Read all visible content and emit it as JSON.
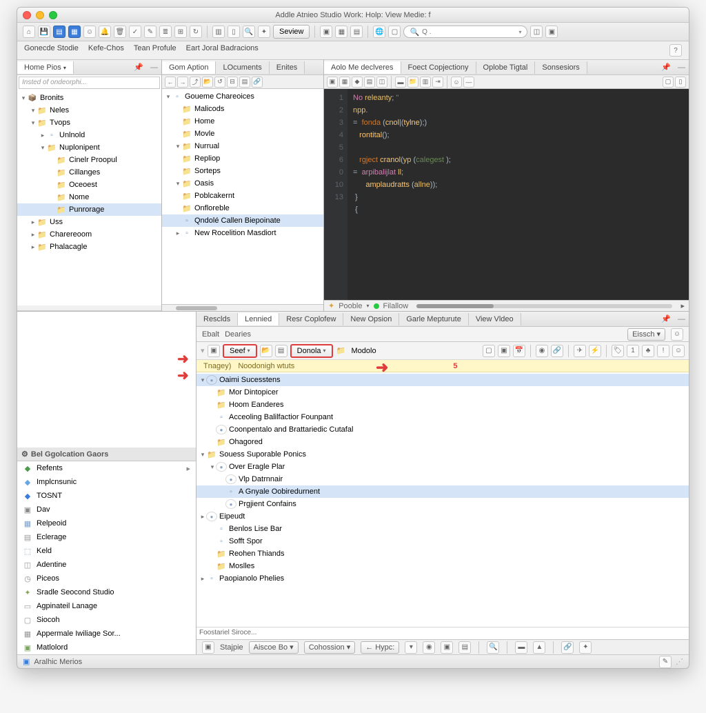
{
  "window": {
    "title": "Addle Atnieo Studio Work: Holp: View Medie: f"
  },
  "menubar": [
    "Gonecde Stodie",
    "Kefe-Chos",
    "Tean Profule",
    "Eart Joral Badracions"
  ],
  "search_placeholder": "Q .",
  "toolbar1_button": "Seview",
  "left_panel": {
    "tab_label": "Home Pios",
    "filter_placeholder": "Insted of ondeorphi...",
    "tree": [
      {
        "label": "Bronits",
        "icon": "pkg",
        "depth": 0,
        "expanded": true
      },
      {
        "label": "Neles",
        "icon": "folder",
        "depth": 1,
        "expanded": true
      },
      {
        "label": "Tvops",
        "icon": "folder",
        "depth": 1,
        "expanded": true
      },
      {
        "label": "Unlnold",
        "icon": "file",
        "depth": 2,
        "expanded": false
      },
      {
        "label": "Nuplonipent",
        "icon": "folder",
        "depth": 2,
        "expanded": true
      },
      {
        "label": "Cinelr Proopul",
        "icon": "folder",
        "depth": 3
      },
      {
        "label": "Cillanges",
        "icon": "folder",
        "depth": 3
      },
      {
        "label": "Oceoest",
        "icon": "folder",
        "depth": 3
      },
      {
        "label": "Nome",
        "icon": "folder",
        "depth": 3
      },
      {
        "label": "Punrorage",
        "icon": "folder",
        "depth": 3,
        "sel": true
      },
      {
        "label": "Uss",
        "icon": "folder",
        "depth": 1,
        "expanded": false
      },
      {
        "label": "Charereoom",
        "icon": "folder",
        "depth": 1,
        "expanded": false
      },
      {
        "label": "Phalacagle",
        "icon": "folder",
        "depth": 1,
        "expanded": false
      }
    ]
  },
  "mid_panel": {
    "tabs": [
      "Gom Aption",
      "LOcuments",
      "Enites"
    ],
    "active_tab": 0,
    "tree": [
      {
        "label": "Goueme Chareoices",
        "icon": "file",
        "depth": 0,
        "expanded": true
      },
      {
        "label": "Malicods",
        "icon": "folder",
        "depth": 1
      },
      {
        "label": "Home",
        "icon": "folder",
        "depth": 1
      },
      {
        "label": "Movle",
        "icon": "folder",
        "depth": 1
      },
      {
        "label": "Nurrual",
        "icon": "folder",
        "depth": 1,
        "expanded": true
      },
      {
        "label": "Repliop",
        "icon": "folder",
        "depth": 1
      },
      {
        "label": "Sorteps",
        "icon": "folder",
        "depth": 1
      },
      {
        "label": "Oasis",
        "icon": "folder",
        "depth": 1,
        "expanded": true
      },
      {
        "label": "Poblcakernt",
        "icon": "folder",
        "depth": 1
      },
      {
        "label": "Onfloreble",
        "icon": "folder",
        "depth": 1
      },
      {
        "label": "Qndolé Callen Biepoinate",
        "icon": "file",
        "depth": 1,
        "sel": true
      },
      {
        "label": "New Rocelition Masdiort",
        "icon": "file",
        "depth": 1,
        "expanded": false
      }
    ]
  },
  "right_panel": {
    "tabs": [
      "Aolo Me declveres",
      "Foect Copjectiony",
      "Oplobe Tigtal",
      "Sonsesiors"
    ],
    "active_tab": 0,
    "code_lines": [
      "1",
      "2",
      "3",
      "4",
      "5",
      "6",
      "0",
      "10",
      "13"
    ],
    "status": {
      "left": "Pooble",
      "right": "Filallow"
    }
  },
  "bottom_tabs": [
    "Resclds",
    "Lennied",
    "Resr Coplofew",
    "New Opsion",
    "Garle Mepturute",
    "View Vldeo"
  ],
  "bottom_active": 1,
  "subbar": {
    "left": "Ebalt",
    "mid": "Dearies",
    "combo": "Eissch"
  },
  "tb_buttons": {
    "seef": "Seef",
    "donola": "Donola",
    "modolo": "Modolo"
  },
  "crumb": {
    "a": "Tnagey)",
    "b": "Noodonigh wtuts",
    "mark": "5"
  },
  "bottom_tree": [
    {
      "label": "Oaimi Sucesstens",
      "icon": "dot",
      "depth": 0,
      "expanded": true,
      "sel": true
    },
    {
      "label": "Mor Dintopicer",
      "icon": "folder",
      "depth": 1
    },
    {
      "label": "Hoom Eanderes",
      "icon": "folder",
      "depth": 1
    },
    {
      "label": "Acceoling Balilfactior Founpant",
      "icon": "file",
      "depth": 1
    },
    {
      "label": "Coonpentalo and Brattariedic Cutafal",
      "icon": "dot",
      "depth": 1
    },
    {
      "label": "Ohagored",
      "icon": "folder",
      "depth": 1
    },
    {
      "label": "Souess Suporable Ponics",
      "icon": "folder",
      "depth": 0,
      "expanded": true
    },
    {
      "label": "Over Eragle Plar",
      "icon": "dot",
      "depth": 1,
      "expanded": true
    },
    {
      "label": "Vlp Datrnnair",
      "icon": "dot",
      "depth": 2
    },
    {
      "label": "A Gnyale Oobiredurnent",
      "icon": "file",
      "depth": 2,
      "sel": true
    },
    {
      "label": "Prgjient Confains",
      "icon": "dot",
      "depth": 2
    },
    {
      "label": "Eipeudt",
      "icon": "dot",
      "depth": 0,
      "expanded": false
    },
    {
      "label": "Benlos Lise Bar",
      "icon": "file",
      "depth": 1
    },
    {
      "label": "Sofft Spor",
      "icon": "file",
      "depth": 1
    },
    {
      "label": "Reohen Thiands",
      "icon": "folder",
      "depth": 1
    },
    {
      "label": "Moslles",
      "icon": "folder",
      "depth": 1
    },
    {
      "label": "Paopianolo Phelies",
      "icon": "file",
      "depth": 0,
      "expanded": false
    }
  ],
  "bottom_status_label": "Foostariel Siroce...",
  "side_panel": {
    "header": "Bel Ggolcation Gaors",
    "items": [
      {
        "label": "Refents",
        "ic": "◆",
        "color": "#4c9a4c",
        "arrow": true
      },
      {
        "label": "Implcnsunic",
        "ic": "◆",
        "color": "#6aa7e0"
      },
      {
        "label": "TOSNT",
        "ic": "◆",
        "color": "#3b7dd8"
      },
      {
        "label": "Dav",
        "ic": "▣",
        "color": "#888"
      },
      {
        "label": "Relpeoid",
        "ic": "▦",
        "color": "#7aa3cc"
      },
      {
        "label": "Eclerage",
        "ic": "▤",
        "color": "#999"
      },
      {
        "label": "Keld",
        "ic": "⬚",
        "color": "#8899aa"
      },
      {
        "label": "Adentine",
        "ic": "◫",
        "color": "#999"
      },
      {
        "label": "Piceos",
        "ic": "◷",
        "color": "#888"
      },
      {
        "label": "Sradle Seocond Studio",
        "ic": "✦",
        "color": "#8aa65c"
      },
      {
        "label": "Agpinateil Lanage",
        "ic": "▭",
        "color": "#999"
      },
      {
        "label": "Siocoh",
        "ic": "▢",
        "color": "#999"
      },
      {
        "label": "Appermale Iwiliage Sor...",
        "ic": "▦",
        "color": "#999"
      },
      {
        "label": "Matlolord",
        "ic": "▣",
        "color": "#7aa65c"
      }
    ]
  },
  "statusbar2": {
    "left": "Stajpie",
    "btns": [
      "Aiscoe Bo",
      "Cohossion",
      "Hypc:"
    ]
  },
  "statusbar_main": "Aralhic Merios"
}
